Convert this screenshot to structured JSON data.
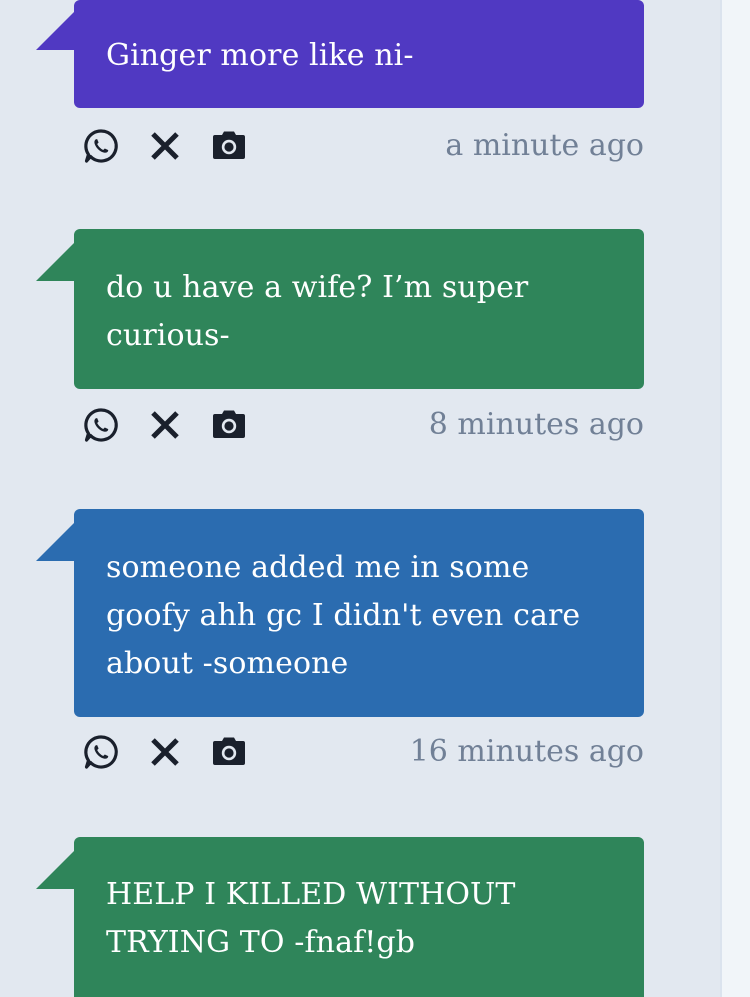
{
  "colors": {
    "background": "#e2e8f0",
    "purple": "#5039c2",
    "green": "#2f855a",
    "blue": "#2b6cb0",
    "icon": "#1a202c",
    "timestamp": "#718096"
  },
  "actions": {
    "whatsapp_icon": "whatsapp-icon",
    "x_icon": "x-icon",
    "camera_icon": "camera-icon"
  },
  "messages": [
    {
      "text": "Ginger more like ni-",
      "time": "a minute ago",
      "color": "purple"
    },
    {
      "text": "do u have a wife? I’m super curious-",
      "time": "8 minutes ago",
      "color": "green"
    },
    {
      "text": "someone added me in some goofy ahh gc I didn't even care about -someone",
      "time": "16 minutes ago",
      "color": "blue"
    },
    {
      "text": "HELP I KILLED WITHOUT TRYING TO -fnaf!gb",
      "time": "",
      "color": "green"
    }
  ]
}
